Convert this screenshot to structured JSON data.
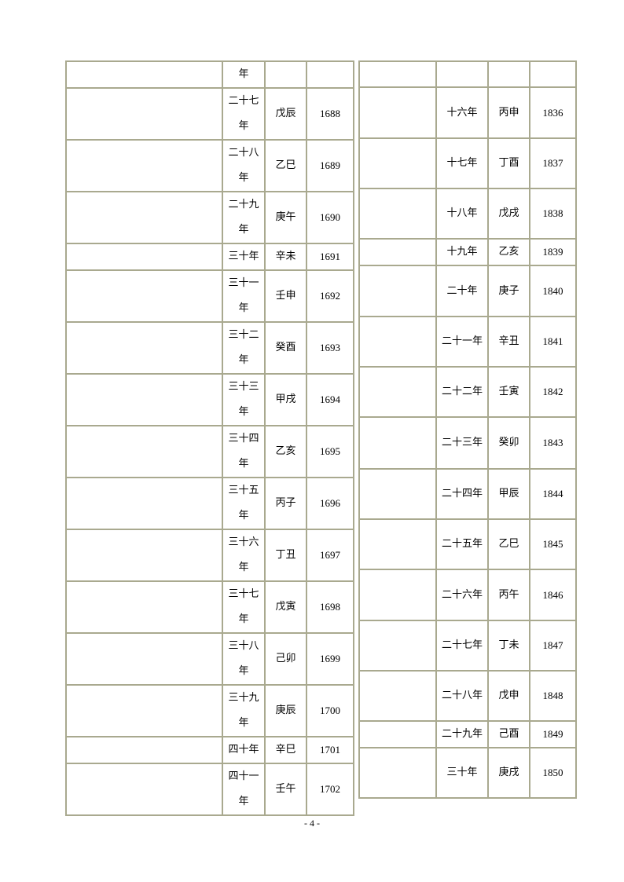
{
  "left_table": {
    "rows": [
      {
        "reign": "",
        "year": "年",
        "ganzhi": "",
        "ad": ""
      },
      {
        "reign": "",
        "year": "二十七年",
        "ganzhi": "戊辰",
        "ad": "1688"
      },
      {
        "reign": "",
        "year": "二十八年",
        "ganzhi": "乙巳",
        "ad": "1689"
      },
      {
        "reign": "",
        "year": "二十九年",
        "ganzhi": "庚午",
        "ad": "1690"
      },
      {
        "reign": "",
        "year": "三十年",
        "ganzhi": "辛未",
        "ad": "1691"
      },
      {
        "reign": "",
        "year": "三十一年",
        "ganzhi": "壬申",
        "ad": "1692"
      },
      {
        "reign": "",
        "year": "三十二年",
        "ganzhi": "癸酉",
        "ad": "1693"
      },
      {
        "reign": "",
        "year": "三十三年",
        "ganzhi": "甲戌",
        "ad": "1694"
      },
      {
        "reign": "",
        "year": "三十四年",
        "ganzhi": "乙亥",
        "ad": "1695"
      },
      {
        "reign": "",
        "year": "三十五年",
        "ganzhi": "丙子",
        "ad": "1696"
      },
      {
        "reign": "",
        "year": "三十六年",
        "ganzhi": "丁丑",
        "ad": "1697"
      },
      {
        "reign": "",
        "year": "三十七年",
        "ganzhi": "戊寅",
        "ad": "1698"
      },
      {
        "reign": "",
        "year": "三十八年",
        "ganzhi": "己卯",
        "ad": "1699"
      },
      {
        "reign": "",
        "year": "三十九年",
        "ganzhi": "庚辰",
        "ad": "1700"
      },
      {
        "reign": "",
        "year": "四十年",
        "ganzhi": "辛巳",
        "ad": "1701"
      },
      {
        "reign": "",
        "year": "四十一年",
        "ganzhi": "壬午",
        "ad": "1702"
      }
    ]
  },
  "right_table": {
    "rows": [
      {
        "reign": "",
        "year": "",
        "ganzhi": "",
        "ad": ""
      },
      {
        "reign": "",
        "year": "十六年",
        "ganzhi": "丙申",
        "ad": "1836"
      },
      {
        "reign": "",
        "year": "十七年",
        "ganzhi": "丁酉",
        "ad": "1837"
      },
      {
        "reign": "",
        "year": "十八年",
        "ganzhi": "戊戌",
        "ad": "1838"
      },
      {
        "reign": "",
        "year": "十九年",
        "ganzhi": "乙亥",
        "ad": "1839"
      },
      {
        "reign": "",
        "year": "二十年",
        "ganzhi": "庚子",
        "ad": "1840"
      },
      {
        "reign": "",
        "year": "二十一年",
        "ganzhi": "辛丑",
        "ad": "1841"
      },
      {
        "reign": "",
        "year": "二十二年",
        "ganzhi": "壬寅",
        "ad": "1842"
      },
      {
        "reign": "",
        "year": "二十三年",
        "ganzhi": "癸卯",
        "ad": "1843"
      },
      {
        "reign": "",
        "year": "二十四年",
        "ganzhi": "甲辰",
        "ad": "1844"
      },
      {
        "reign": "",
        "year": "二十五年",
        "ganzhi": "乙巳",
        "ad": "1845"
      },
      {
        "reign": "",
        "year": "二十六年",
        "ganzhi": "丙午",
        "ad": "1846"
      },
      {
        "reign": "",
        "year": "二十七年",
        "ganzhi": "丁未",
        "ad": "1847"
      },
      {
        "reign": "",
        "year": "二十八年",
        "ganzhi": "戊申",
        "ad": "1848"
      },
      {
        "reign": "",
        "year": "二十九年",
        "ganzhi": "己酉",
        "ad": "1849"
      },
      {
        "reign": "",
        "year": "三十年",
        "ganzhi": "庚戌",
        "ad": "1850"
      }
    ]
  },
  "footer": {
    "page_number": "- 4 -"
  }
}
